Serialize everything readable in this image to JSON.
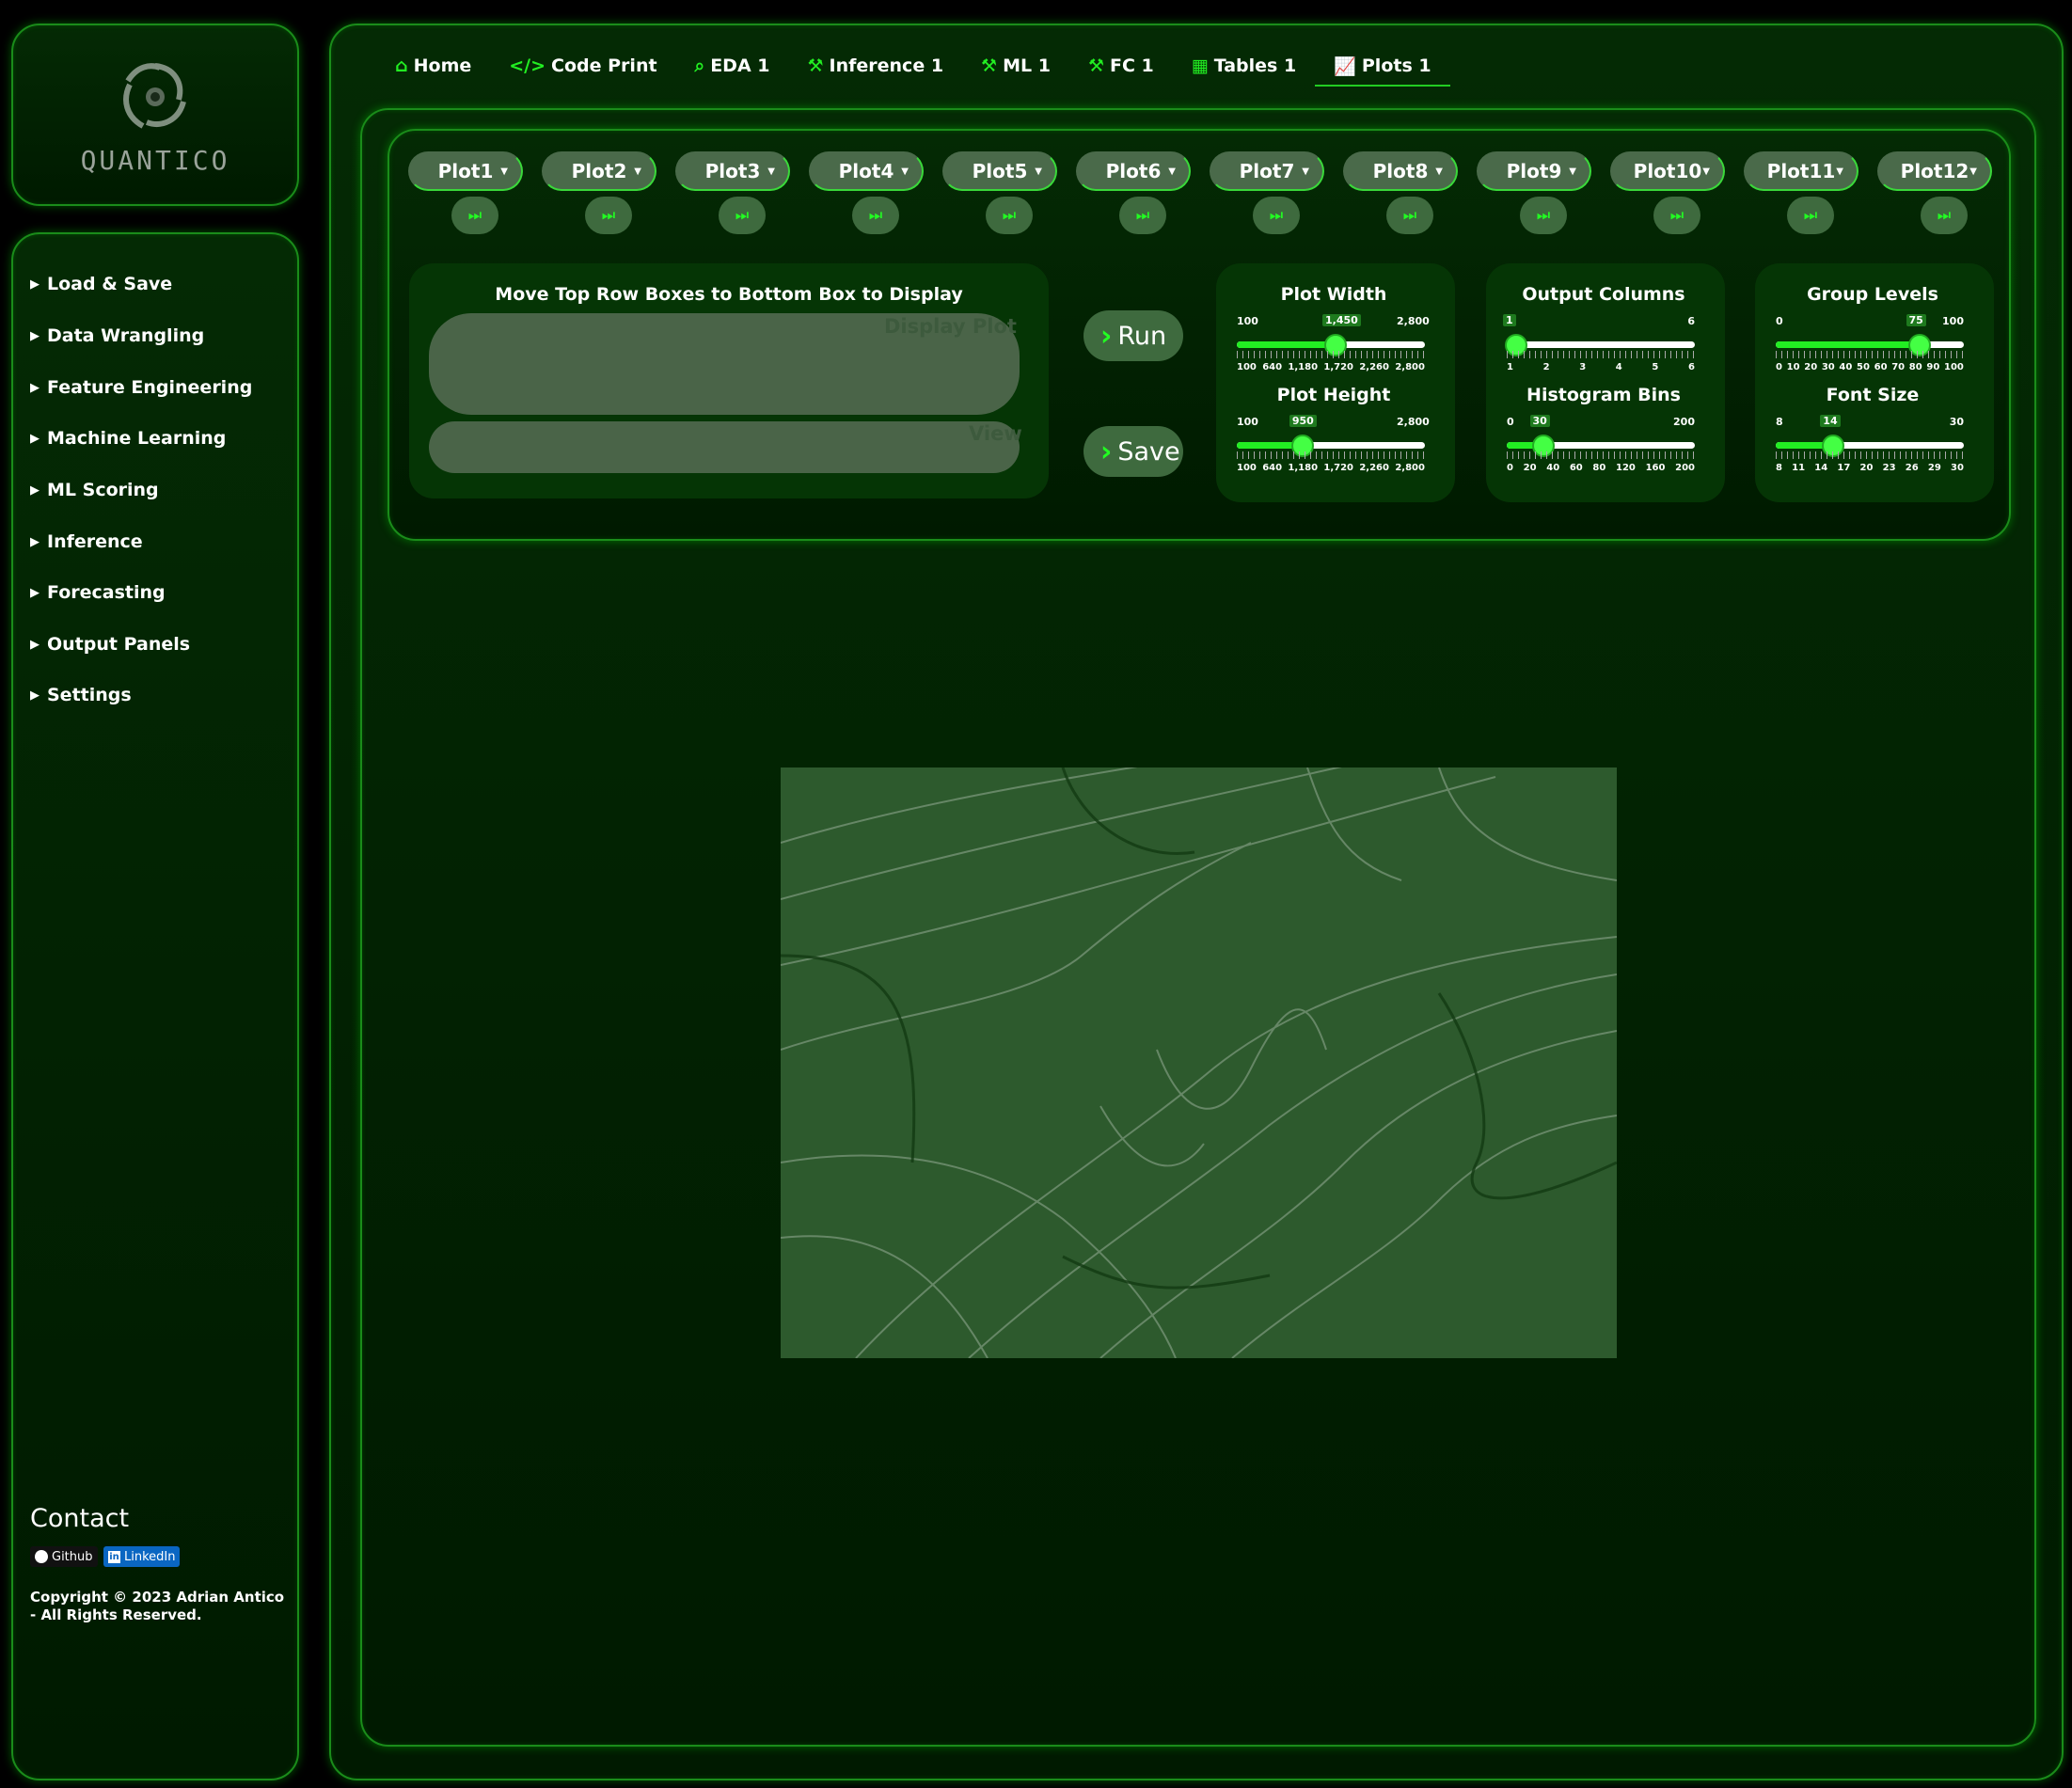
{
  "brand": {
    "name": "QUANTICO"
  },
  "sidebar": {
    "items": [
      {
        "label": "Load & Save"
      },
      {
        "label": "Data Wrangling"
      },
      {
        "label": "Feature Engineering"
      },
      {
        "label": "Machine Learning"
      },
      {
        "label": "ML Scoring"
      },
      {
        "label": "Inference"
      },
      {
        "label": "Forecasting"
      },
      {
        "label": "Output Panels"
      },
      {
        "label": "Settings"
      }
    ],
    "contact_title": "Contact",
    "github_label": "Github",
    "linkedin_label": "LinkedIn",
    "copyright": "Copyright © 2023 Adrian Antico - All Rights Reserved."
  },
  "tabs": [
    {
      "label": "Home",
      "icon": "home-icon"
    },
    {
      "label": "Code Print",
      "icon": "code-icon"
    },
    {
      "label": "EDA 1",
      "icon": "search-icon"
    },
    {
      "label": "Inference 1",
      "icon": "wand-icon"
    },
    {
      "label": "ML 1",
      "icon": "wand-icon"
    },
    {
      "label": "FC 1",
      "icon": "wand-icon"
    },
    {
      "label": "Tables 1",
      "icon": "table-icon"
    },
    {
      "label": "Plots 1",
      "icon": "line-chart-icon",
      "active": true
    }
  ],
  "plots": [
    "Plot1",
    "Plot2",
    "Plot3",
    "Plot4",
    "Plot5",
    "Plot6",
    "Plot7",
    "Plot8",
    "Plot9",
    "Plot10",
    "Plot11",
    "Plot12"
  ],
  "drop": {
    "title": "Move Top Row Boxes to Bottom Box to Display",
    "display_placeholder": "Display Plot",
    "view_placeholder": "View"
  },
  "actions": {
    "run": "Run",
    "save": "Save"
  },
  "sliders": {
    "plot_width": {
      "title": "Plot Width",
      "min": "100",
      "max": "2,800",
      "value": "1,450",
      "fraction": 0.5,
      "ticks": [
        "100",
        "640",
        "1,180",
        "1,720",
        "2,260",
        "2,800"
      ]
    },
    "plot_height": {
      "title": "Plot Height",
      "min": "100",
      "max": "2,800",
      "value": "950",
      "fraction": 0.315,
      "ticks": [
        "100",
        "640",
        "1,180",
        "1,720",
        "2,260",
        "2,800"
      ]
    },
    "output_columns": {
      "title": "Output Columns",
      "min": "1",
      "max": "6",
      "value": "1",
      "fraction": 0.0,
      "ticks": [
        "1",
        "2",
        "3",
        "4",
        "5",
        "6"
      ]
    },
    "histogram_bins": {
      "title": "Histogram Bins",
      "min": "0",
      "max": "200",
      "value": "30",
      "fraction": 0.15,
      "ticks": [
        "0",
        "20",
        "40",
        "60",
        "80",
        "120",
        "160",
        "200"
      ]
    },
    "group_levels": {
      "title": "Group Levels",
      "min": "0",
      "max": "100",
      "value": "75",
      "fraction": 0.75,
      "ticks": [
        "0",
        "10",
        "20",
        "30",
        "40",
        "50",
        "60",
        "70",
        "80",
        "90",
        "100"
      ]
    },
    "font_size": {
      "title": "Font Size",
      "min": "8",
      "max": "30",
      "value": "14",
      "fraction": 0.27,
      "ticks": [
        "8",
        "11",
        "14",
        "17",
        "20",
        "23",
        "26",
        "29",
        "30"
      ]
    }
  },
  "colors": {
    "accent": "#22ee22",
    "panel": "#053505",
    "background": "#000000"
  }
}
